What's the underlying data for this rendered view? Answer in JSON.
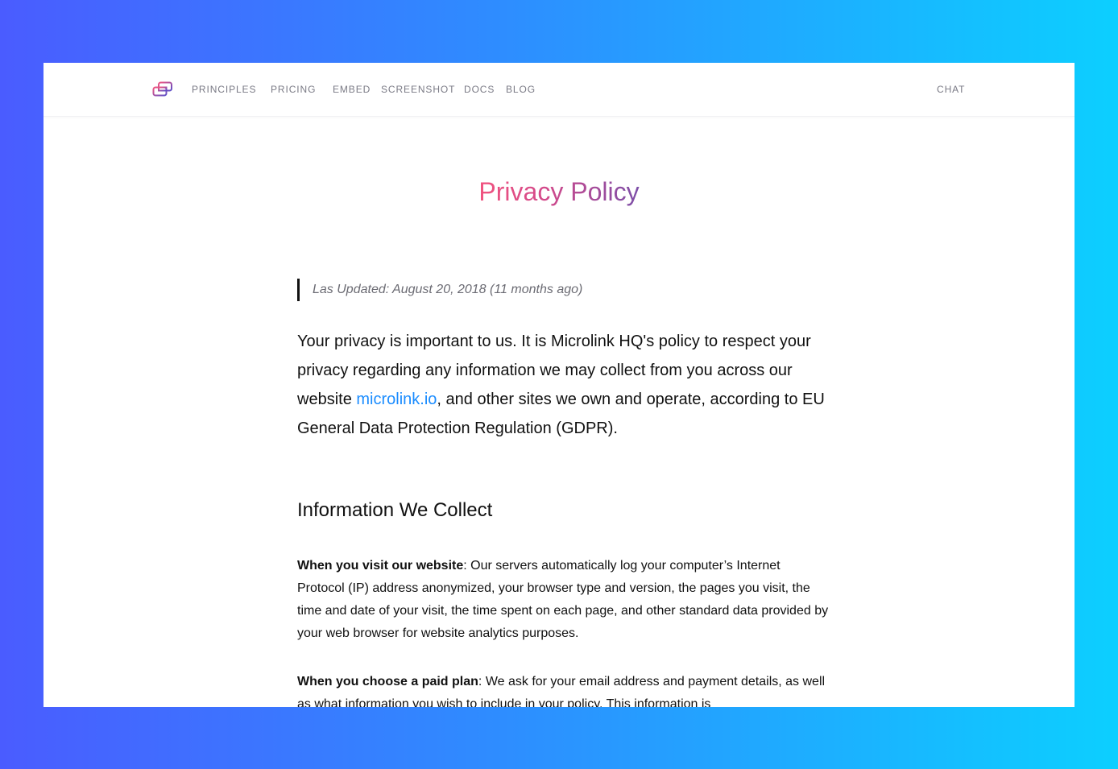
{
  "nav": {
    "items": [
      {
        "label": "PRINCIPLES"
      },
      {
        "label": "PRICING"
      },
      {
        "label": "EMBED"
      },
      {
        "label": "SCREENSHOT"
      },
      {
        "label": "DOCS"
      },
      {
        "label": "BLOG"
      }
    ],
    "chat_label": "CHAT"
  },
  "page": {
    "title": "Privacy Policy",
    "last_updated": "Las Updated: August 20, 2018 (11 months ago)",
    "intro": {
      "before_link": "Your privacy is important to us. It is Microlink HQ's policy to respect your privacy regarding any information we may collect from you across our website ",
      "link_text": "microlink.io",
      "after_link": ", and other sites we own and operate, according to EU General Data Protection Regulation (GDPR)."
    },
    "section_heading": "Information We Collect",
    "paragraphs": [
      {
        "bold": "When you visit our website",
        "text": ": Our servers automatically log your computer’s Internet Protocol (IP) address anonymized, your browser type and version, the pages you visit, the time and date of your visit, the time spent on each page, and other standard data provided by your web browser for website analytics purposes."
      },
      {
        "bold": "When you choose a paid plan",
        "text": ": We ask for your email address and payment details, as well as what information you wish to include in your policy. This information is"
      }
    ]
  },
  "colors": {
    "link": "#1a8cff",
    "title_gradient_start": "#f1547f",
    "title_gradient_end": "#7c4ea8",
    "background_gradient_start": "#4a5cff",
    "background_gradient_end": "#0ccfff"
  },
  "icons": {
    "logo": "microlink-logo-icon"
  }
}
